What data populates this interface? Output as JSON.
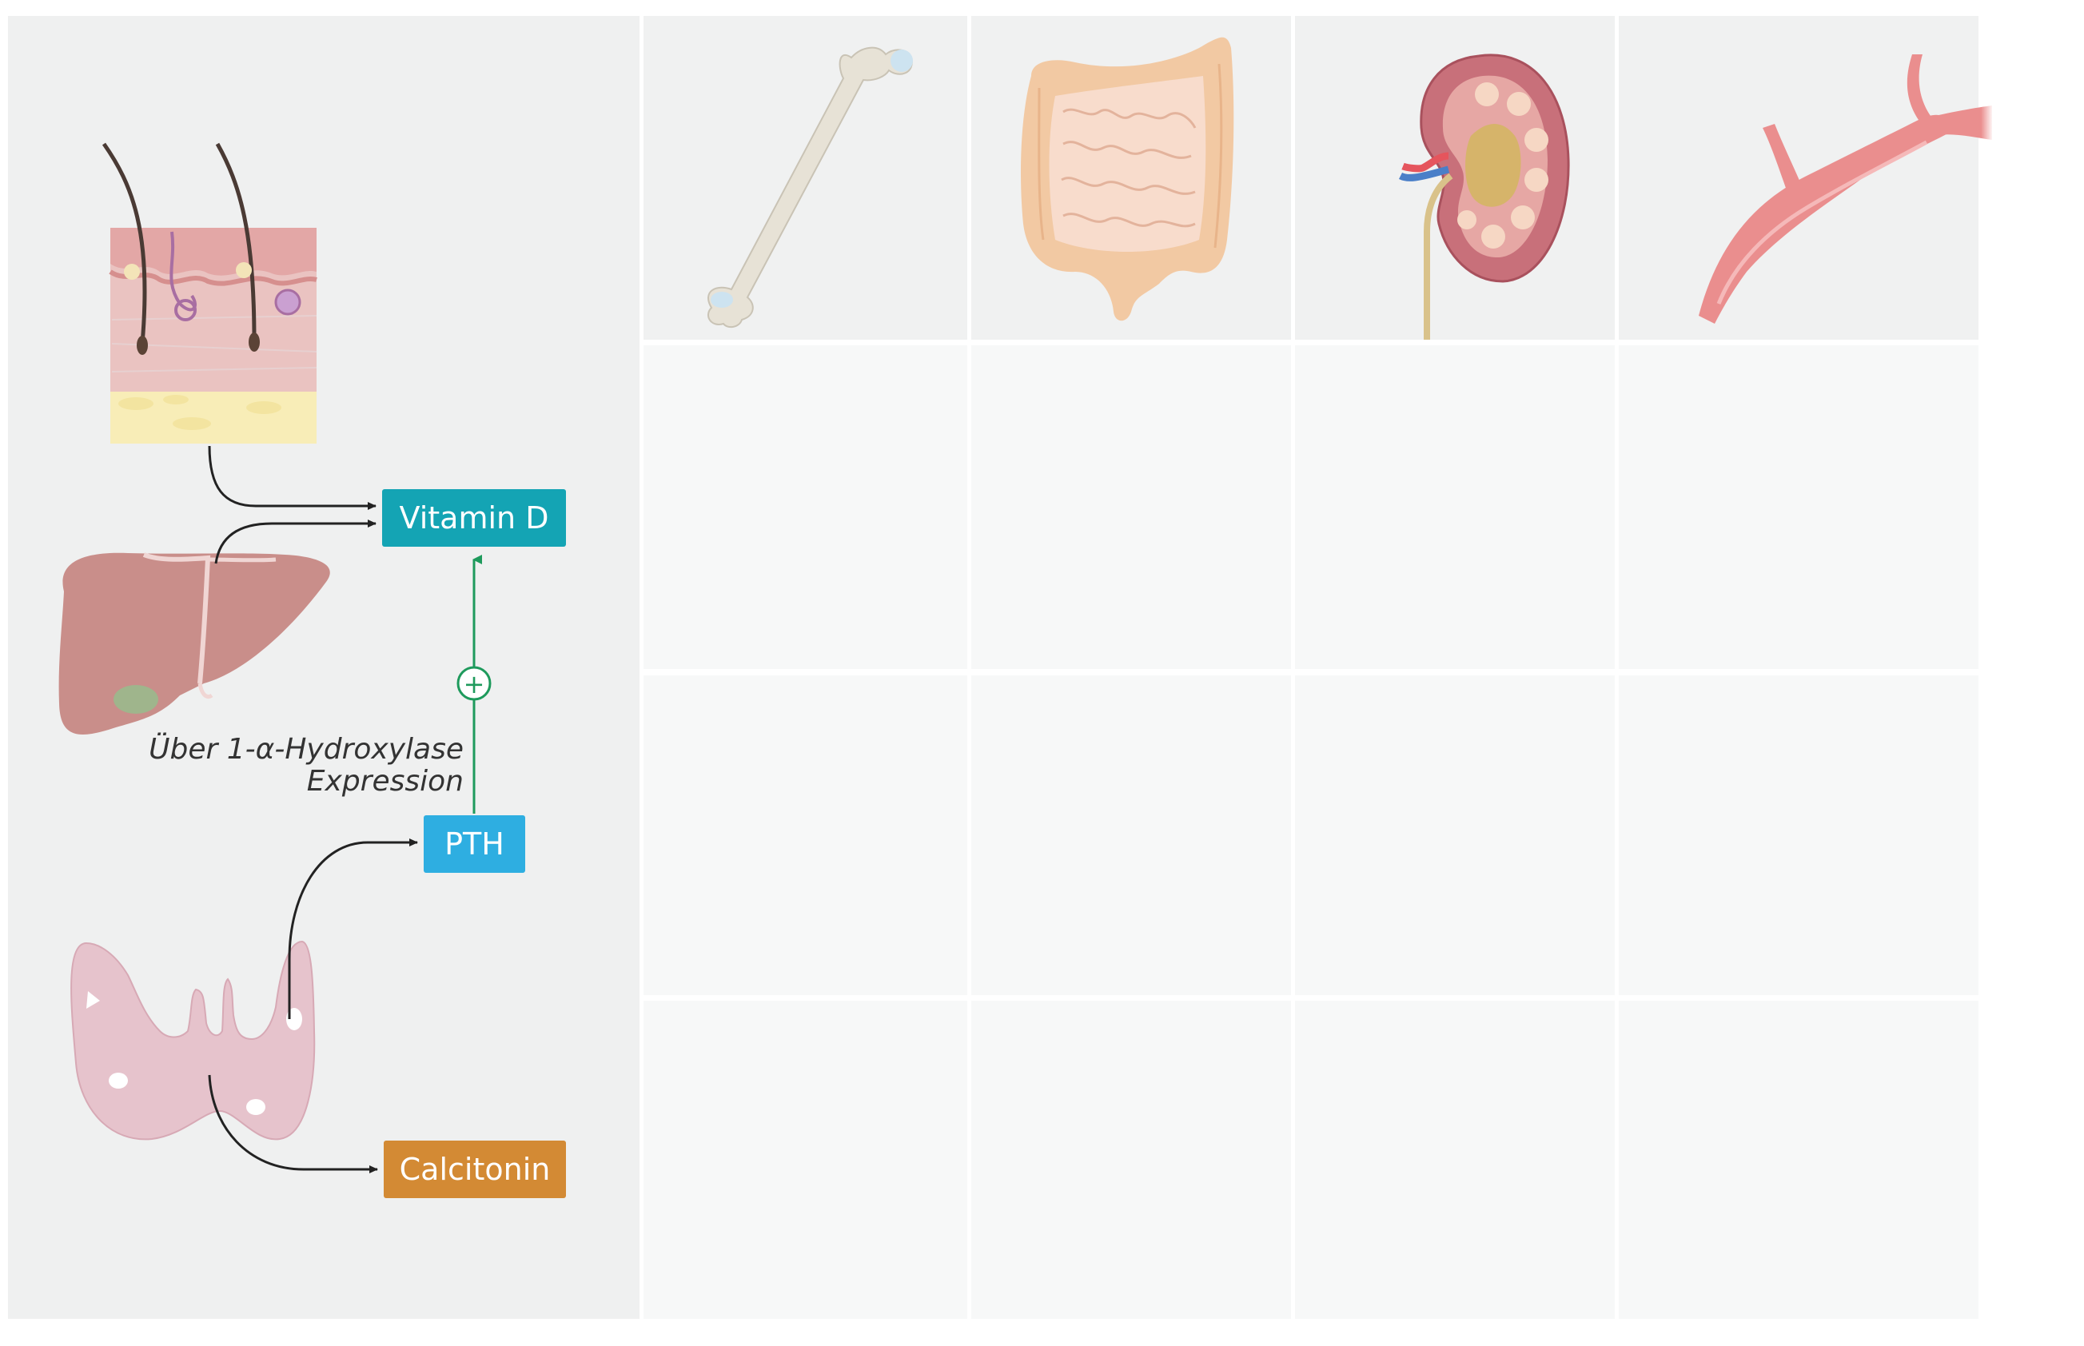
{
  "labels": {
    "vitamin_d": "Vitamin D",
    "pth": "PTH",
    "calcitonin": "Calcitonin",
    "note_line1": "Über 1-α-Hydroxylase",
    "note_line2": "Expression",
    "plus_sign": "+"
  },
  "colors": {
    "vitamin_d": "#14a4b4",
    "pth": "#2eaee1",
    "calcitonin": "#d38a34",
    "activation_arrow": "#1e9a5c",
    "arrow": "#222222"
  },
  "organs": {
    "left": [
      "skin-icon",
      "liver-icon",
      "thyroid-icon"
    ],
    "columns": [
      "bone-icon",
      "intestine-icon",
      "kidney-icon",
      "blood-vessel-icon"
    ]
  }
}
